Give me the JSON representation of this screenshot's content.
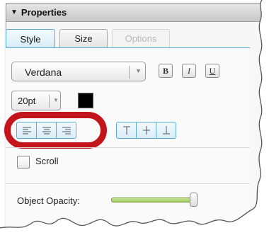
{
  "panel": {
    "title": "Properties"
  },
  "tabs": [
    {
      "label": "Style",
      "state": "active"
    },
    {
      "label": "Size",
      "state": "normal"
    },
    {
      "label": "Options",
      "state": "disabled"
    }
  ],
  "font": {
    "family": "Verdana"
  },
  "format_buttons": {
    "bold": "B",
    "italic": "I",
    "underline": "U"
  },
  "size": {
    "value": "20pt"
  },
  "text_color": "#000000",
  "horizontal_align": [
    "left",
    "center",
    "right"
  ],
  "vertical_align": [
    "top",
    "middle",
    "bottom"
  ],
  "scroll": {
    "label": "Scroll",
    "checked": false
  },
  "opacity": {
    "label": "Object Opacity:",
    "value": 1.0
  },
  "colors": {
    "accent": "#5ea9d8",
    "highlight": "#c2151c",
    "slider_fill": "#9fcd5a"
  }
}
